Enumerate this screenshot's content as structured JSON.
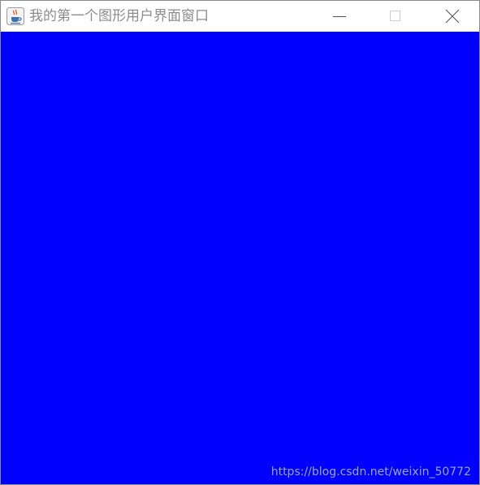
{
  "window": {
    "title": "我的第一个图形用户界面窗口",
    "app_icon": "java-coffee-cup-icon",
    "controls": {
      "minimize_icon": "minimize-icon",
      "maximize_icon": "maximize-icon",
      "close_icon": "close-icon"
    }
  },
  "content": {
    "background_color": "#0000ff"
  },
  "watermark": {
    "text": "https://blog.csdn.net/weixin_50772"
  }
}
